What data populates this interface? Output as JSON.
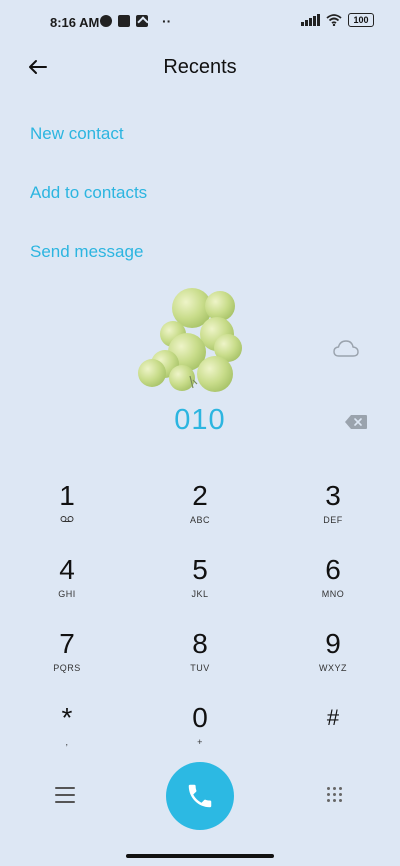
{
  "status_bar": {
    "time": "8:16 AM",
    "battery": "100"
  },
  "header": {
    "title": "Recents",
    "back_icon": "arrow-left-icon"
  },
  "actions": {
    "new_contact": "New contact",
    "add_to_contacts": "Add to contacts",
    "send_message": "Send message"
  },
  "dialer": {
    "number": "010",
    "keys": [
      {
        "digit": "1",
        "sub": "voicemail-icon"
      },
      {
        "digit": "2",
        "sub": "ABC"
      },
      {
        "digit": "3",
        "sub": "DEF"
      },
      {
        "digit": "4",
        "sub": "GHI"
      },
      {
        "digit": "5",
        "sub": "JKL"
      },
      {
        "digit": "6",
        "sub": "MNO"
      },
      {
        "digit": "7",
        "sub": "PQRS"
      },
      {
        "digit": "8",
        "sub": "TUV"
      },
      {
        "digit": "9",
        "sub": "WXYZ"
      },
      {
        "digit": "*",
        "sub": ","
      },
      {
        "digit": "0",
        "sub": "+"
      },
      {
        "digit": "#",
        "sub": ""
      }
    ]
  },
  "colors": {
    "background": "#dde7f4",
    "accent": "#2cb5e0",
    "call_button": "#2cb9e3"
  }
}
